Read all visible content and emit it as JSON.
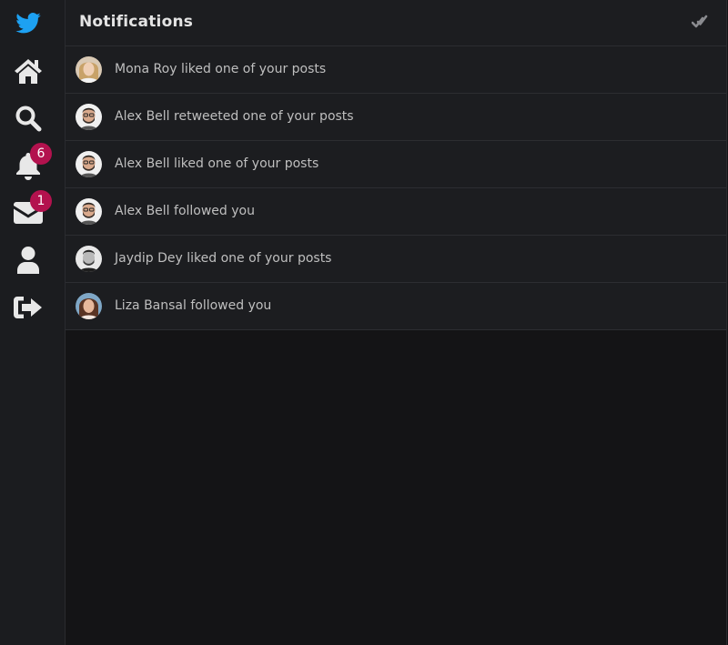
{
  "sidebar": {
    "logo_icon": "bird-logo-icon",
    "items": [
      {
        "icon": "home-icon"
      },
      {
        "icon": "search-icon"
      },
      {
        "icon": "bell-icon",
        "badge": "6"
      },
      {
        "icon": "envelope-icon",
        "badge": "1"
      },
      {
        "icon": "user-icon"
      },
      {
        "icon": "sign-out-icon"
      }
    ]
  },
  "header": {
    "title": "Notifications",
    "mark_read_icon": "double-check-icon"
  },
  "notifications": [
    {
      "text": "Mona Roy liked one of your posts"
    },
    {
      "text": "Alex Bell retweeted one of your posts"
    },
    {
      "text": "Alex Bell liked one of your posts"
    },
    {
      "text": "Alex Bell followed you"
    },
    {
      "text": "Jaydip Dey liked one of your posts"
    },
    {
      "text": "Liza Bansal followed you"
    }
  ],
  "colors": {
    "brand": "#1da1f2",
    "badge": "#b3124e",
    "sidebar_bg": "#1b1c1f",
    "row_bg": "#1c1d20",
    "page_bg": "#141416",
    "text": "#bfbfbf",
    "icon": "#e8e8e8"
  }
}
